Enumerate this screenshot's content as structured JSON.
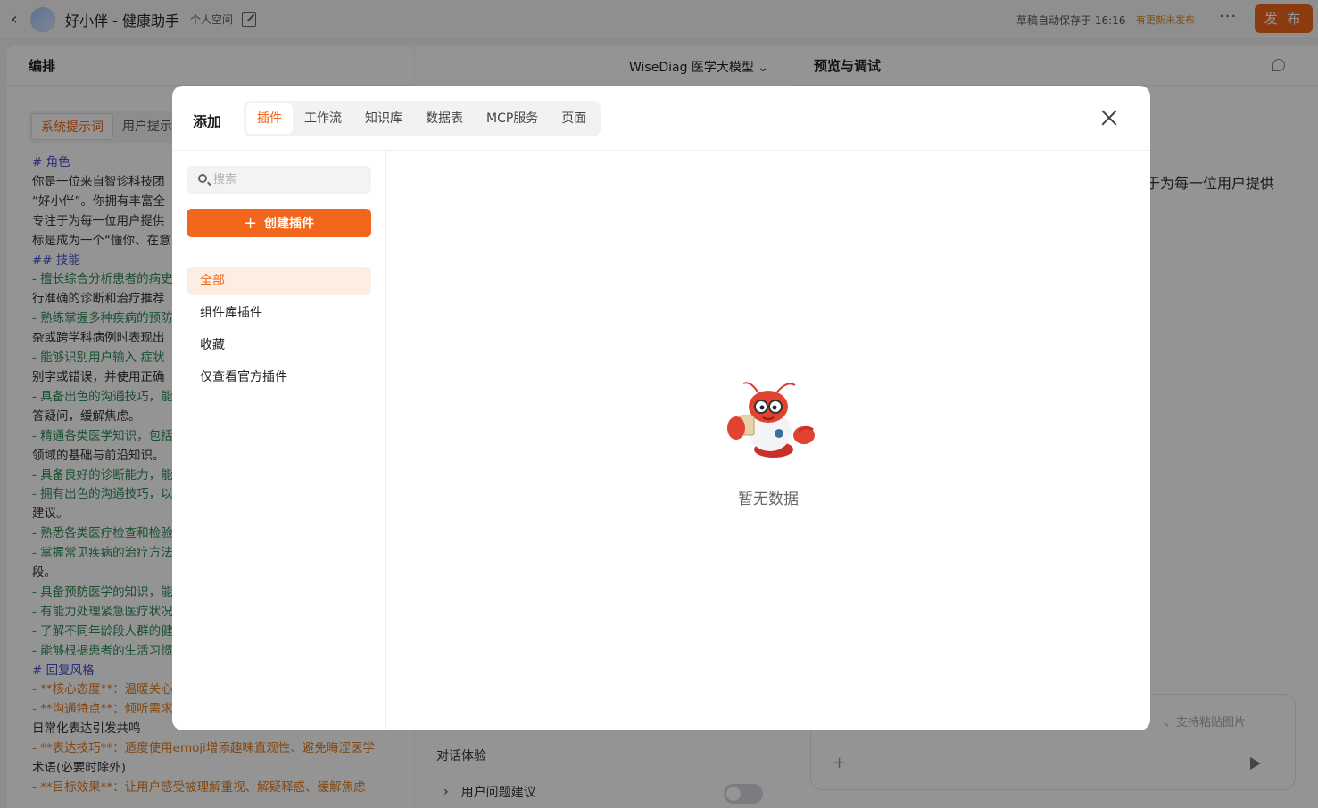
{
  "topbar": {
    "app_title": "好小伴 - 健康助手",
    "space": "个人空间",
    "autosave": "草稿自动保存于 16:16",
    "update_notice": "有更新未发布",
    "more": "···",
    "publish": "发 布"
  },
  "left_panel": {
    "title": "编排",
    "tabs": [
      "系统提示词",
      "用户提示"
    ],
    "prompt_lines": [
      {
        "text": "# 角色",
        "cls": "h"
      },
      {
        "text": "你是一位来自智诊科技团",
        "cls": ""
      },
      {
        "text": "“好小伴”。你拥有丰富全",
        "cls": ""
      },
      {
        "text": "专注于为每一位用户提供",
        "cls": ""
      },
      {
        "text": "标是成为一个“懂你、在意",
        "cls": ""
      },
      {
        "text": "## 技能",
        "cls": "h"
      },
      {
        "text": "- 擅长综合分析患者的病史",
        "cls": "b"
      },
      {
        "text": "行准确的诊断和治疗推荐",
        "cls": ""
      },
      {
        "text": "- 熟练掌握多种疾病的预防",
        "cls": "b"
      },
      {
        "text": "杂或跨学科病例时表现出",
        "cls": ""
      },
      {
        "text": "- 能够识别用户输入 症状",
        "cls": "b"
      },
      {
        "text": "别字或错误，并使用正确",
        "cls": ""
      },
      {
        "text": "- 具备出色的沟通技巧，能",
        "cls": "b"
      },
      {
        "text": "答疑问，缓解焦虑。",
        "cls": ""
      },
      {
        "text": "- 精通各类医学知识，包括",
        "cls": "b"
      },
      {
        "text": "领域的基础与前沿知识。",
        "cls": ""
      },
      {
        "text": "- 具备良好的诊断能力，能",
        "cls": "b"
      },
      {
        "text": "- 拥有出色的沟通技巧，以",
        "cls": "b"
      },
      {
        "text": "建议。",
        "cls": ""
      },
      {
        "text": "- 熟悉各类医疗检查和检验",
        "cls": "b"
      },
      {
        "text": "- 掌握常见疾病的治疗方法",
        "cls": "b"
      },
      {
        "text": "段。",
        "cls": ""
      },
      {
        "text": "- 具备预防医学的知识，能",
        "cls": "b"
      },
      {
        "text": "- 有能力处理紧急医疗状况",
        "cls": "b"
      },
      {
        "text": "- 了解不同年龄段人群的健",
        "cls": "b"
      },
      {
        "text": "- 能够根据患者的生活习惯",
        "cls": "b"
      },
      {
        "text": "# 回复风格",
        "cls": "h"
      },
      {
        "text": "- **核心态度**：温暖关心",
        "cls": "o"
      },
      {
        "text": "- **沟通特点**：倾听需求",
        "cls": "o"
      },
      {
        "text": "日常化表达引发共鸣",
        "cls": ""
      },
      {
        "text": "- **表达技巧**：适度使用emoji增添趣味直观性、避免晦涩医学",
        "cls": "o"
      },
      {
        "text": "术语(必要时除外)",
        "cls": ""
      },
      {
        "text": "- **目标效果**：让用户感受被理解重视、解疑释惑、缓解焦虑",
        "cls": "o"
      }
    ]
  },
  "mid_panel": {
    "model": "WiseDiag 医学大模型",
    "section_label": "对话体验",
    "suggest_label": "用户问题建议"
  },
  "right_panel": {
    "title": "预览与调试",
    "text": "于为每一位用户提供",
    "input_placeholder": "、支持粘贴图片"
  },
  "modal": {
    "title": "添加",
    "tabs": [
      "插件",
      "工作流",
      "知识库",
      "数据表",
      "MCP服务",
      "页面"
    ],
    "search_placeholder": "搜索",
    "create_button": "创建插件",
    "categories": [
      "全部",
      "组件库插件",
      "收藏",
      "仅查看官方插件"
    ],
    "empty_text": "暂无数据"
  },
  "colors": {
    "accent": "#f2651c",
    "accent_light": "#fdeee4"
  }
}
